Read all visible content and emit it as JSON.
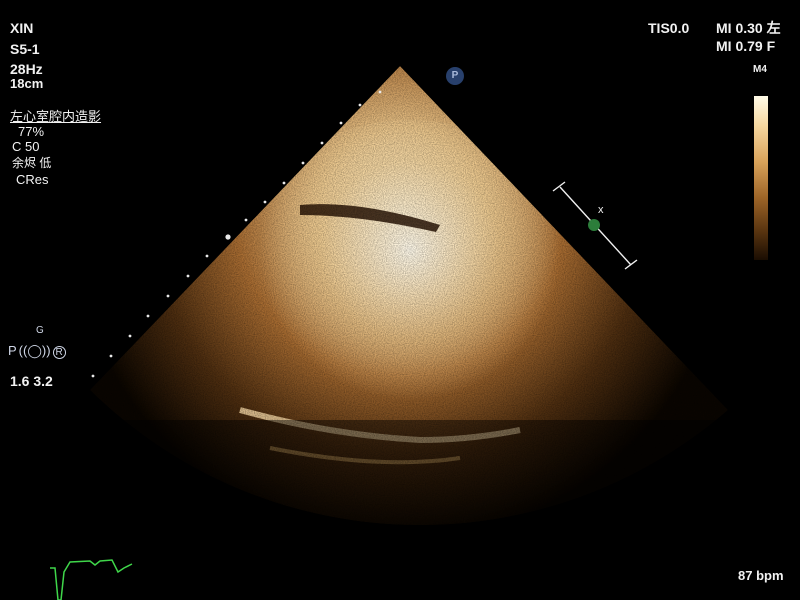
{
  "top_left": {
    "exam": "XIN",
    "probe": "S5-1",
    "frame_rate": "28Hz",
    "depth": "18cm"
  },
  "preset": {
    "mode_label": "左心室腔内造影",
    "power": "77%",
    "compression": "C 50",
    "persistence": "余烬 低",
    "resolution": "CRes"
  },
  "top_right": {
    "tis": "TIS0.0",
    "mi_1": "MI 0.30 左",
    "mi_2": "MI 0.79 F",
    "map": "M4"
  },
  "focus_marker": "x",
  "probe_indicator": "P",
  "gain_panel": {
    "g_label": "G",
    "p_label": "P",
    "r_label": "R",
    "values": "1.6  3.2"
  },
  "heart_rate": "87 bpm",
  "colors": {
    "echo_bright": "#fff2d0",
    "echo_mid": "#b8793a",
    "ecg": "#3fd64a",
    "focus_dot": "#2c7d3a"
  }
}
